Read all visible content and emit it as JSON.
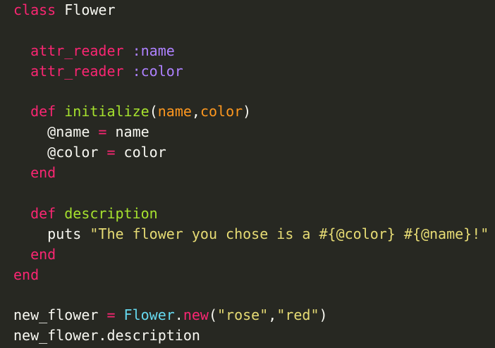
{
  "editor": {
    "lines": [
      {
        "tokens": [
          {
            "t": "class",
            "c": "kw"
          },
          {
            "t": " Flower",
            "c": "plain"
          }
        ]
      },
      {
        "tokens": []
      },
      {
        "tokens": [
          {
            "t": "  ",
            "c": "plain"
          },
          {
            "t": "attr_reader",
            "c": "kw"
          },
          {
            "t": " ",
            "c": "plain"
          },
          {
            "t": ":name",
            "c": "sym"
          }
        ]
      },
      {
        "tokens": [
          {
            "t": "  ",
            "c": "plain"
          },
          {
            "t": "attr_reader",
            "c": "kw"
          },
          {
            "t": " ",
            "c": "plain"
          },
          {
            "t": ":color",
            "c": "sym"
          }
        ]
      },
      {
        "tokens": []
      },
      {
        "tokens": [
          {
            "t": "  ",
            "c": "plain"
          },
          {
            "t": "def",
            "c": "kw"
          },
          {
            "t": " ",
            "c": "plain"
          },
          {
            "t": "initialize",
            "c": "fn"
          },
          {
            "t": "(",
            "c": "plain"
          },
          {
            "t": "name",
            "c": "param"
          },
          {
            "t": ",",
            "c": "plain"
          },
          {
            "t": "color",
            "c": "param"
          },
          {
            "t": ")",
            "c": "plain"
          }
        ]
      },
      {
        "tokens": [
          {
            "t": "    @name ",
            "c": "plain"
          },
          {
            "t": "=",
            "c": "op"
          },
          {
            "t": " name",
            "c": "plain"
          }
        ]
      },
      {
        "tokens": [
          {
            "t": "    @color ",
            "c": "plain"
          },
          {
            "t": "=",
            "c": "op"
          },
          {
            "t": " color",
            "c": "plain"
          }
        ]
      },
      {
        "tokens": [
          {
            "t": "  ",
            "c": "plain"
          },
          {
            "t": "end",
            "c": "kw"
          }
        ]
      },
      {
        "tokens": []
      },
      {
        "tokens": [
          {
            "t": "  ",
            "c": "plain"
          },
          {
            "t": "def",
            "c": "kw"
          },
          {
            "t": " ",
            "c": "plain"
          },
          {
            "t": "description",
            "c": "fn"
          }
        ]
      },
      {
        "tokens": [
          {
            "t": "    puts ",
            "c": "plain"
          },
          {
            "t": "\"The flower you chose is a #{@color} #{@name}!\"",
            "c": "str"
          }
        ]
      },
      {
        "tokens": [
          {
            "t": "  ",
            "c": "plain"
          },
          {
            "t": "end",
            "c": "kw"
          }
        ]
      },
      {
        "tokens": [
          {
            "t": "end",
            "c": "kw"
          }
        ]
      },
      {
        "tokens": []
      },
      {
        "tokens": [
          {
            "t": "new_flower ",
            "c": "plain"
          },
          {
            "t": "=",
            "c": "op"
          },
          {
            "t": " ",
            "c": "plain"
          },
          {
            "t": "Flower",
            "c": "cls"
          },
          {
            "t": ".",
            "c": "plain"
          },
          {
            "t": "new",
            "c": "kw"
          },
          {
            "t": "(",
            "c": "plain"
          },
          {
            "t": "\"rose\"",
            "c": "str"
          },
          {
            "t": ",",
            "c": "plain"
          },
          {
            "t": "\"red\"",
            "c": "str"
          },
          {
            "t": ")",
            "c": "plain"
          }
        ]
      },
      {
        "tokens": [
          {
            "t": "new_flower.description",
            "c": "plain"
          }
        ]
      }
    ]
  },
  "colors": {
    "background": "#272822",
    "keyword": "#f92672",
    "function": "#a6e22e",
    "symbol": "#ae81ff",
    "parameter": "#fd971f",
    "string": "#e6db74",
    "class": "#66d9ef",
    "text": "#f8f8f2"
  }
}
